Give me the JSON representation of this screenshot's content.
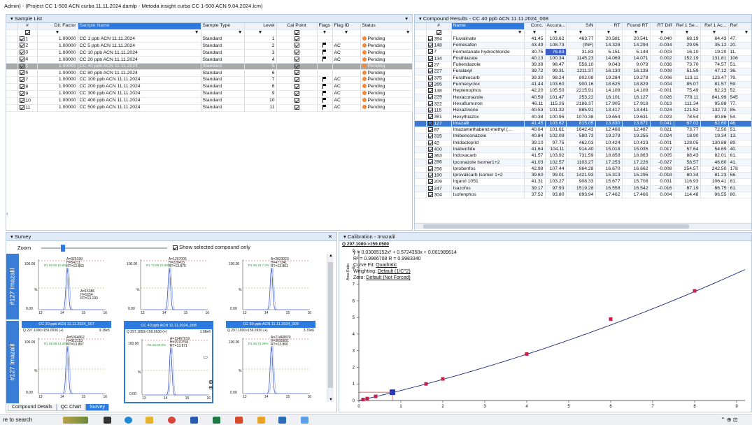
{
  "window_title": "Admin) - (Project  CC 1-500 ACN curba 11.11.2024.damlp - Metoda insight curba CC 1-500 ACN  9.04.2024.lcm)",
  "sample_list": {
    "title": "Sample List",
    "columns": [
      "#",
      "Dil. Factor",
      "Sample Name",
      "Sample Type",
      "Level",
      "Cal Point",
      "Flags",
      "Flag ID",
      "Status"
    ],
    "rows": [
      {
        "n": "1",
        "dil": "1.00000",
        "name": "CC 1 ppb ACN 11.11.2024",
        "type": "Standard",
        "level": "1",
        "flag": false,
        "flag_id": "",
        "status": "Pending"
      },
      {
        "n": "2",
        "dil": "1.00000",
        "name": "CC 5 ppb ACN 11.11.2024",
        "type": "Standard",
        "level": "2",
        "flag": true,
        "flag_id": "AC",
        "status": "Pending"
      },
      {
        "n": "3",
        "dil": "1.00000",
        "name": "CC 10 ppb ACN 11.11.2024",
        "type": "Standard",
        "level": "3",
        "flag": true,
        "flag_id": "AC",
        "status": "Pending"
      },
      {
        "n": "4",
        "dil": "1.00000",
        "name": "CC 20 ppb ACN 11.11.2024",
        "type": "Standard",
        "level": "4",
        "flag": true,
        "flag_id": "AC",
        "status": "Pending"
      },
      {
        "n": "5",
        "dil": "1.00000",
        "name": "CC 40 ppb ACN 11.11.2024",
        "type": "Standard",
        "level": "5",
        "flag": false,
        "flag_id": "",
        "status": "Pending"
      },
      {
        "n": "6",
        "dil": "1.00000",
        "name": "CC 80 ppb ACN 11.11.2024",
        "type": "Standard",
        "level": "6",
        "flag": false,
        "flag_id": "",
        "status": "Pending"
      },
      {
        "n": "7",
        "dil": "1.00000",
        "name": "CC 100 ppb ACN 11.11.2024",
        "type": "Standard",
        "level": "7",
        "flag": true,
        "flag_id": "AC",
        "status": "Pending"
      },
      {
        "n": "8",
        "dil": "1.00000",
        "name": "CC 200 ppb ACN 11.11.2024",
        "type": "Standard",
        "level": "8",
        "flag": true,
        "flag_id": "AC",
        "status": "Pending"
      },
      {
        "n": "9",
        "dil": "1.00000",
        "name": "CC 300 ppb ACN 11.11.2024",
        "type": "Standard",
        "level": "9",
        "flag": true,
        "flag_id": "AC",
        "status": "Pending"
      },
      {
        "n": "10",
        "dil": "1.00000",
        "name": "CC 400 ppb ACN 11.11.2024",
        "type": "Standard",
        "level": "10",
        "flag": true,
        "flag_id": "AC",
        "status": "Pending"
      },
      {
        "n": "11",
        "dil": "1.00000",
        "name": "CC 500 ppb ACN 11.11.2024",
        "type": "Standard",
        "level": "11",
        "flag": true,
        "flag_id": "AC",
        "status": "Pending"
      }
    ],
    "selected_index": 4
  },
  "compound_results": {
    "title": "Compound Results - CC 40 ppb ACN 11.11.2024_008",
    "columns": [
      "#",
      "Name",
      "Conc.",
      "Accura...",
      "S/N",
      "RT",
      "Found RT",
      "RT Diff",
      "Ref 1 Se...",
      "Ref 1 Ac...",
      "Ref"
    ],
    "rows": [
      [
        "394",
        "Fluvalinate",
        "41.45",
        "103.62",
        "463.77",
        "20.581",
        "20.541",
        "-0.040",
        "68.19",
        "64.43",
        "47."
      ],
      [
        "148",
        "Fomesafen",
        "43.49",
        "108.73",
        "(INF)",
        "14.328",
        "14.294",
        "-0.034",
        "29.95",
        "35.12",
        "20."
      ],
      [
        "7",
        "Formetanate hydrochloride",
        "30.75",
        "76.89",
        "31.83",
        "5.151",
        "5.148",
        "-0.003",
        "16.10",
        "19.20",
        "11."
      ],
      [
        "134",
        "Fosthiazate",
        "40.13",
        "100.34",
        "1145.23",
        "14.069",
        "14.071",
        "0.002",
        "152.19",
        "131.81",
        "106"
      ],
      [
        "27",
        "Fuberidazole",
        "39.39",
        "98.47",
        "556.10",
        "9.043",
        "9.079",
        "0.036",
        "73.70",
        "74.57",
        "51."
      ],
      [
        "227",
        "Furalaxyl",
        "39.72",
        "99.31",
        "1211.37",
        "16.130",
        "16.138",
        "0.008",
        "51.59",
        "47.12",
        "36."
      ],
      [
        "375",
        "Furathiocarb",
        "39.30",
        "98.24",
        "802.08",
        "19.284",
        "19.278",
        "-0.006",
        "113.11",
        "123.47",
        "79."
      ],
      [
        "265",
        "Furmecyclox",
        "41.44",
        "103.60",
        "900.16",
        "18.625",
        "18.829",
        "0.004",
        "85.07",
        "81.57",
        "59."
      ],
      [
        "138",
        "Heptenophos",
        "42.20",
        "105.50",
        "2215.91",
        "14.109",
        "14.109",
        "-0.001",
        "75.49",
        "62.23",
        "52."
      ],
      [
        "229",
        "Hexaconazole",
        "40.59",
        "101.47",
        "253.22",
        "16.101",
        "16.127",
        "0.026",
        "779.11",
        "841.99",
        "545"
      ],
      [
        "322",
        "Hexaflumuron",
        "46.11",
        "115.26",
        "2186.37",
        "17.905",
        "17.918",
        "0.013",
        "111.34",
        "95.88",
        "77."
      ],
      [
        "115",
        "Hexazinone",
        "40.53",
        "101.32",
        "885.91",
        "13.417",
        "13.441",
        "0.024",
        "121.52",
        "132.72",
        "85."
      ],
      [
        "381",
        "Hexythiazox",
        "40.38",
        "100.95",
        "1070.38",
        "19.654",
        "19.631",
        "-0.023",
        "78.54",
        "80.86",
        "54."
      ],
      [
        "127",
        "Imazalil",
        "41.45",
        "103.62",
        "815.05",
        "13.830",
        "13.871",
        "0.041",
        "67.02",
        "62.60",
        "46."
      ],
      [
        "87",
        "Imazamethabenz-methyl (...",
        "40.64",
        "101.61",
        "1642.43",
        "12.466",
        "12.487",
        "0.021",
        "73.77",
        "72.50",
        "51."
      ],
      [
        "315",
        "Imibenconazole",
        "40.84",
        "102.09",
        "580.73",
        "19.279",
        "19.255",
        "-0.024",
        "18.90",
        "19.34",
        "13."
      ],
      [
        "42",
        "Imidacloprid",
        "39.10",
        "97.75",
        "462.03",
        "10.424",
        "10.423",
        "-0.001",
        "128.05",
        "130.88",
        "89."
      ],
      [
        "400",
        "Inabenfide",
        "41.64",
        "104.11",
        "914.40",
        "15.018",
        "15.035",
        "0.017",
        "57.64",
        "54.69",
        "40."
      ],
      [
        "363",
        "Indoxacarb",
        "41.57",
        "103.92",
        "731.59",
        "18.858",
        "18.863",
        "0.005",
        "88.43",
        "82.01",
        "61."
      ],
      [
        "286",
        "Ipconazole Isomer1+2",
        "41.03",
        "102.57",
        "1103.27",
        "17.253",
        "17.226",
        "-0.027",
        "58.57",
        "46.60",
        "41."
      ],
      [
        "256",
        "Iprobenfos",
        "42.98",
        "107.44",
        "864.28",
        "16.670",
        "16.662",
        "-0.008",
        "254.57",
        "242.50",
        "178"
      ],
      [
        "190",
        "Iprovalicarb Isomer 1+2",
        "39.60",
        "99.01",
        "1421.93",
        "15.313",
        "15.295",
        "-0.018",
        "80.34",
        "81.23",
        "56."
      ],
      [
        "209",
        "Irgarol 1051",
        "41.31",
        "103.27",
        "908.33",
        "15.677",
        "15.708",
        "0.031",
        "116.93",
        "106.41",
        "81."
      ],
      [
        "247",
        "Isazofos",
        "39.17",
        "97.93",
        "1519.28",
        "16.558",
        "16.542",
        "-0.016",
        "87.19",
        "86.75",
        "61."
      ],
      [
        "304",
        "Isofenphos",
        "37.52",
        "93.80",
        "893.94",
        "17.462",
        "17.466",
        "0.004",
        "114.48",
        "96.55",
        "80."
      ]
    ],
    "selected_index": 13,
    "highlight_cell": "76.89"
  },
  "survey": {
    "title": "Survey",
    "zoom_label": "Zoom",
    "show_selected_label": "Show selected compound only",
    "row_label": "#127 Imazalil",
    "top_tiles": [
      {
        "peak": "A=325199",
        "h": "H=54211",
        "rt": "RT=13.863",
        "extra": [
          "A=15386",
          "H=1654",
          "RT=13.193"
        ],
        "ratio": "R1 60.60",
        "pct": "10.9%"
      },
      {
        "peak": "A=1267005",
        "h": "H=228415",
        "rt": "RT=13.875",
        "extra": [],
        "ratio": "R1 72.98",
        "pct": "15.08%"
      },
      {
        "peak": "A=2823023",
        "h": "H=477341",
        "rt": "RT=13.861",
        "extra": [],
        "ratio": "R1 65.15",
        "pct": "7.2%"
      }
    ],
    "bottom_tiles": [
      {
        "title": "CC 20 ppb ACN 11.11.2024_007",
        "mz": "Q 297.1000>159.0930 (+)",
        "scale": "9.15e5",
        "peak": "A=5064862",
        "h": "H=912153",
        "rt": "RT=13.867",
        "ratio": "R1 68.98",
        "pct": "14.28%",
        "selected": false
      },
      {
        "title": "CC 40 ppb ACN 11.11.2024_008",
        "mz": "Q 297.1000>159.0930 (+)",
        "scale": "1.98e6",
        "peak": "A=11467019",
        "h": "H=1970758",
        "rt": "RT=13.871",
        "ratio": "R1 62.60",
        "pct": "8%",
        "selected": true
      },
      {
        "title": "CC 80 ppb ACN 11.11.2024_009",
        "mz": "Q 297.1000>159.0930 (+)",
        "scale": "3.70e6",
        "peak": "A=21468820",
        "h": "H=3695601",
        "rt": "RT=13.860",
        "ratio": "R1 65.73",
        "pct": "26%",
        "selected": false
      }
    ],
    "ytick_top": "100.00",
    "ytick_mid": "%",
    "ytick_bot": "0.00",
    "xticks": [
      "13",
      "14",
      "15",
      "16"
    ]
  },
  "calibration": {
    "title": "Calibration - Imazalil",
    "mz": "Q 297.1000->159.0500",
    "equation": "y = 0.03085152x² + 0.5724350x + 0.001989614",
    "r2": "R² = 0.9966708   R = 0.9983340",
    "curve_fit_label": "Curve Fit:",
    "curve_fit_value": "Quadratic",
    "weighting_label": "Weighting:",
    "weighting_value": "Default (1/C^2)",
    "zero_label": "Zero:",
    "zero_value": "Default (Not Forced)",
    "ylabel": "Area Ratio",
    "yticks": [
      "9",
      "8",
      "7",
      "6",
      "5",
      "4",
      "3",
      "2",
      "1",
      "0"
    ],
    "xticks": [
      "0",
      "1",
      "2",
      "3",
      "4",
      "5",
      "6",
      "7",
      "8",
      "9"
    ]
  },
  "chart_data": {
    "type": "scatter",
    "title": "Calibration - Imazalil",
    "xlabel": "",
    "ylabel": "Area Ratio",
    "xlim": [
      0,
      9.2
    ],
    "ylim": [
      0,
      9
    ],
    "points": [
      [
        0.1,
        0.06
      ],
      [
        0.2,
        0.12
      ],
      [
        0.4,
        0.25
      ],
      [
        0.8,
        0.5
      ],
      [
        1.6,
        1.0
      ],
      [
        2.0,
        1.3
      ],
      [
        4.0,
        2.8
      ],
      [
        6.0,
        4.9
      ],
      [
        8.0,
        6.6
      ]
    ],
    "selected_point": [
      0.8,
      0.5
    ],
    "curve": {
      "a": 0.03085152,
      "b": 0.572435,
      "c": 0.001989614
    }
  },
  "bottom_tabs": [
    "Compound Details",
    "QC Chart",
    "Survey"
  ],
  "active_bottom_tab": 2,
  "taskbar": {
    "search_text": "re to search"
  }
}
